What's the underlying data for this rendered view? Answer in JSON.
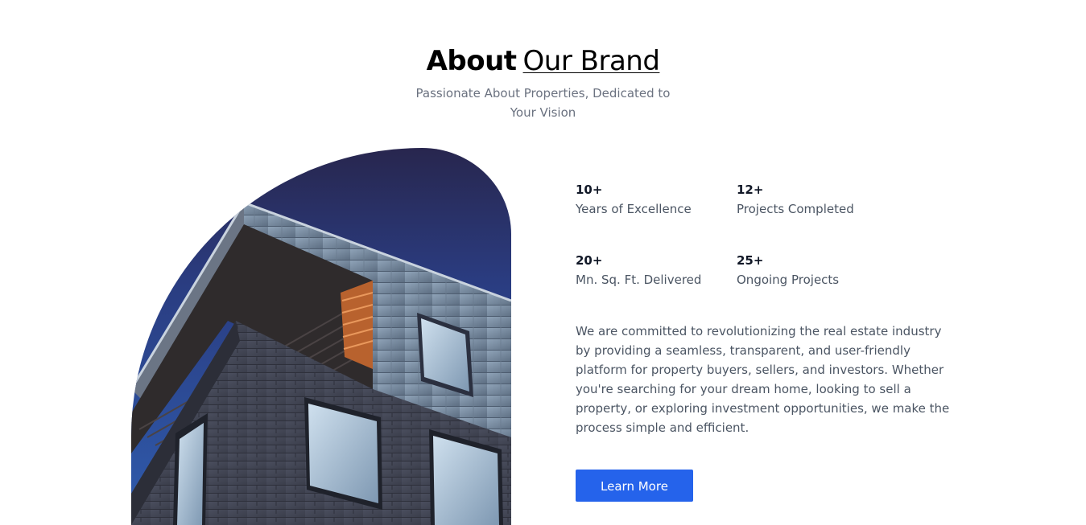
{
  "header": {
    "title_bold": "About",
    "title_light": "Our Brand",
    "subtitle": "Passionate About Properties, Dedicated to Your Vision"
  },
  "stats": [
    {
      "value": "10+",
      "label": "Years of Excellence"
    },
    {
      "value": "12+",
      "label": "Projects Completed"
    },
    {
      "value": "20+",
      "label": "Mn. Sq. Ft. Delivered"
    },
    {
      "value": "25+",
      "label": "Ongoing Projects"
    }
  ],
  "description": "We are committed to revolutionizing the real estate industry by providing a seamless, transparent, and user-friendly platform for property buyers, sellers, and investors. Whether you're searching for your dream home, looking to sell a property, or exploring investment opportunities, we make the process simple and efficient.",
  "cta": {
    "label": "Learn More"
  },
  "colors": {
    "accent": "#2563eb",
    "sky_top": "#2a2850",
    "sky_bottom": "#2d5aa8",
    "text_muted": "#4b5563"
  }
}
